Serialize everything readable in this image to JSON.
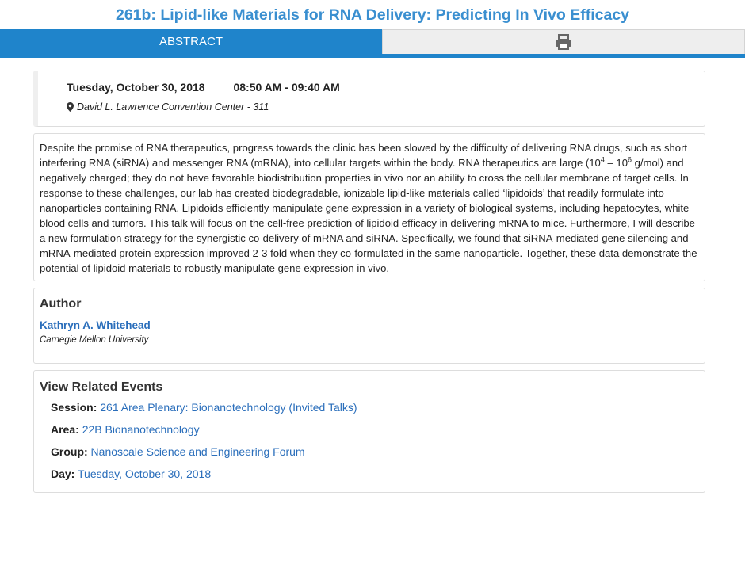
{
  "title": "261b: Lipid-like Materials for RNA Delivery: Predicting In Vivo Efficacy",
  "tabs": {
    "abstract_label": "ABSTRACT",
    "print_icon": "print-icon"
  },
  "schedule": {
    "date": "Tuesday, October 30, 2018",
    "time": "08:50 AM - 09:40 AM",
    "location": "David L. Lawrence Convention Center - 311"
  },
  "abstract": {
    "p1": "Despite the promise of RNA therapeutics, progress towards the clinic has been slowed by the difficulty of delivering RNA drugs, such as short interfering RNA (siRNA) and messenger RNA (mRNA), into cellular targets within the body. RNA therapeutics are large (10",
    "exp1": "4",
    "p2": " – 10",
    "exp2": "6",
    "p3": " g/mol) and negatively charged; they do not have favorable biodistribution properties in vivo nor an ability to cross the cellular membrane of target cells. In response to these challenges, our lab has created biodegradable, ionizable lipid-like materials called ‘lipidoids’ that readily formulate into nanoparticles containing RNA. Lipidoids efficiently manipulate gene expression in a variety of biological systems, including hepatocytes, white blood cells and tumors. This talk will focus on the cell-free prediction of lipidoid efficacy in delivering mRNA to mice. Furthermore, I will describe a new formulation strategy for the synergistic co-delivery of mRNA and siRNA. Specifically, we found that siRNA-mediated gene silencing and mRNA-mediated protein expression improved 2-3 fold when they co-formulated in the same nanoparticle. Together, these data demonstrate the potential of lipidoid materials to robustly manipulate gene expression in vivo."
  },
  "author": {
    "heading": "Author",
    "name": "Kathryn A. Whitehead",
    "affiliation": "Carnegie Mellon University"
  },
  "related": {
    "heading": "View Related Events",
    "items": [
      {
        "label": "Session:",
        "value": "261 Area Plenary: Bionanotechnology (Invited Talks)"
      },
      {
        "label": "Area:",
        "value": "22B Bionanotechnology"
      },
      {
        "label": "Group:",
        "value": "Nanoscale Science and Engineering Forum"
      },
      {
        "label": "Day:",
        "value": "Tuesday, October 30, 2018"
      }
    ]
  }
}
